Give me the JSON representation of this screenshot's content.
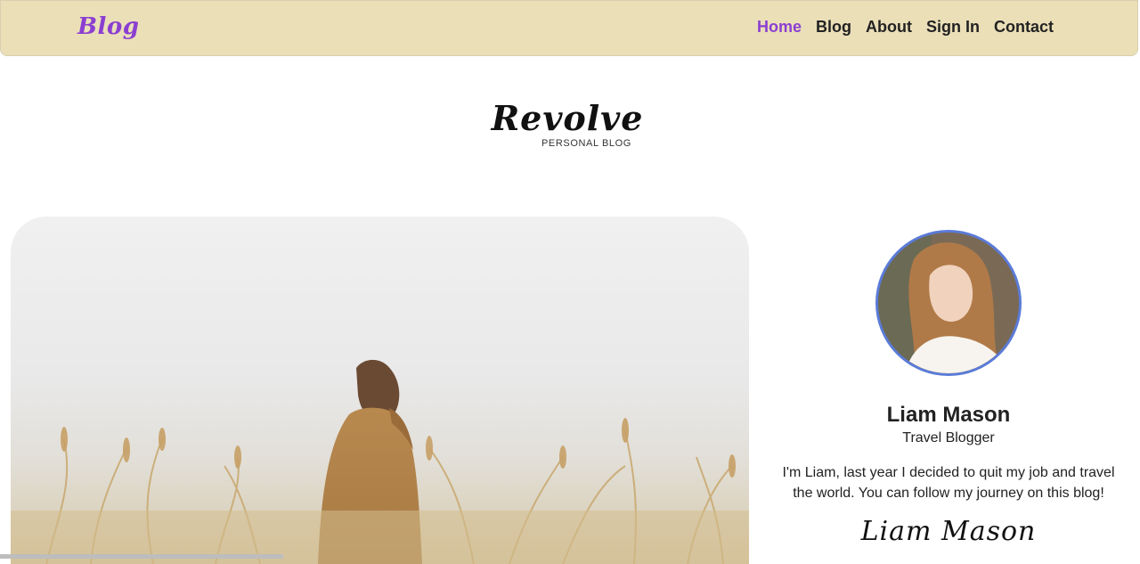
{
  "navbar": {
    "brand": "Blog",
    "links": [
      {
        "label": "Home",
        "active": true
      },
      {
        "label": "Blog",
        "active": false
      },
      {
        "label": "About",
        "active": false
      },
      {
        "label": "Sign In",
        "active": false
      },
      {
        "label": "Contact",
        "active": false
      }
    ]
  },
  "site": {
    "title": "Revolve",
    "subtitle": "PERSONAL BLOG"
  },
  "profile": {
    "name": "Liam Mason",
    "role": "Travel Blogger",
    "bio": "I'm Liam, last year I decided to quit my job and travel the world. You can follow my journey on this blog!",
    "signature": "Liam Mason"
  },
  "colors": {
    "navbar_bg": "#ebdfb8",
    "accent": "#8b3fd1",
    "avatar_border": "#5a7bd8"
  }
}
